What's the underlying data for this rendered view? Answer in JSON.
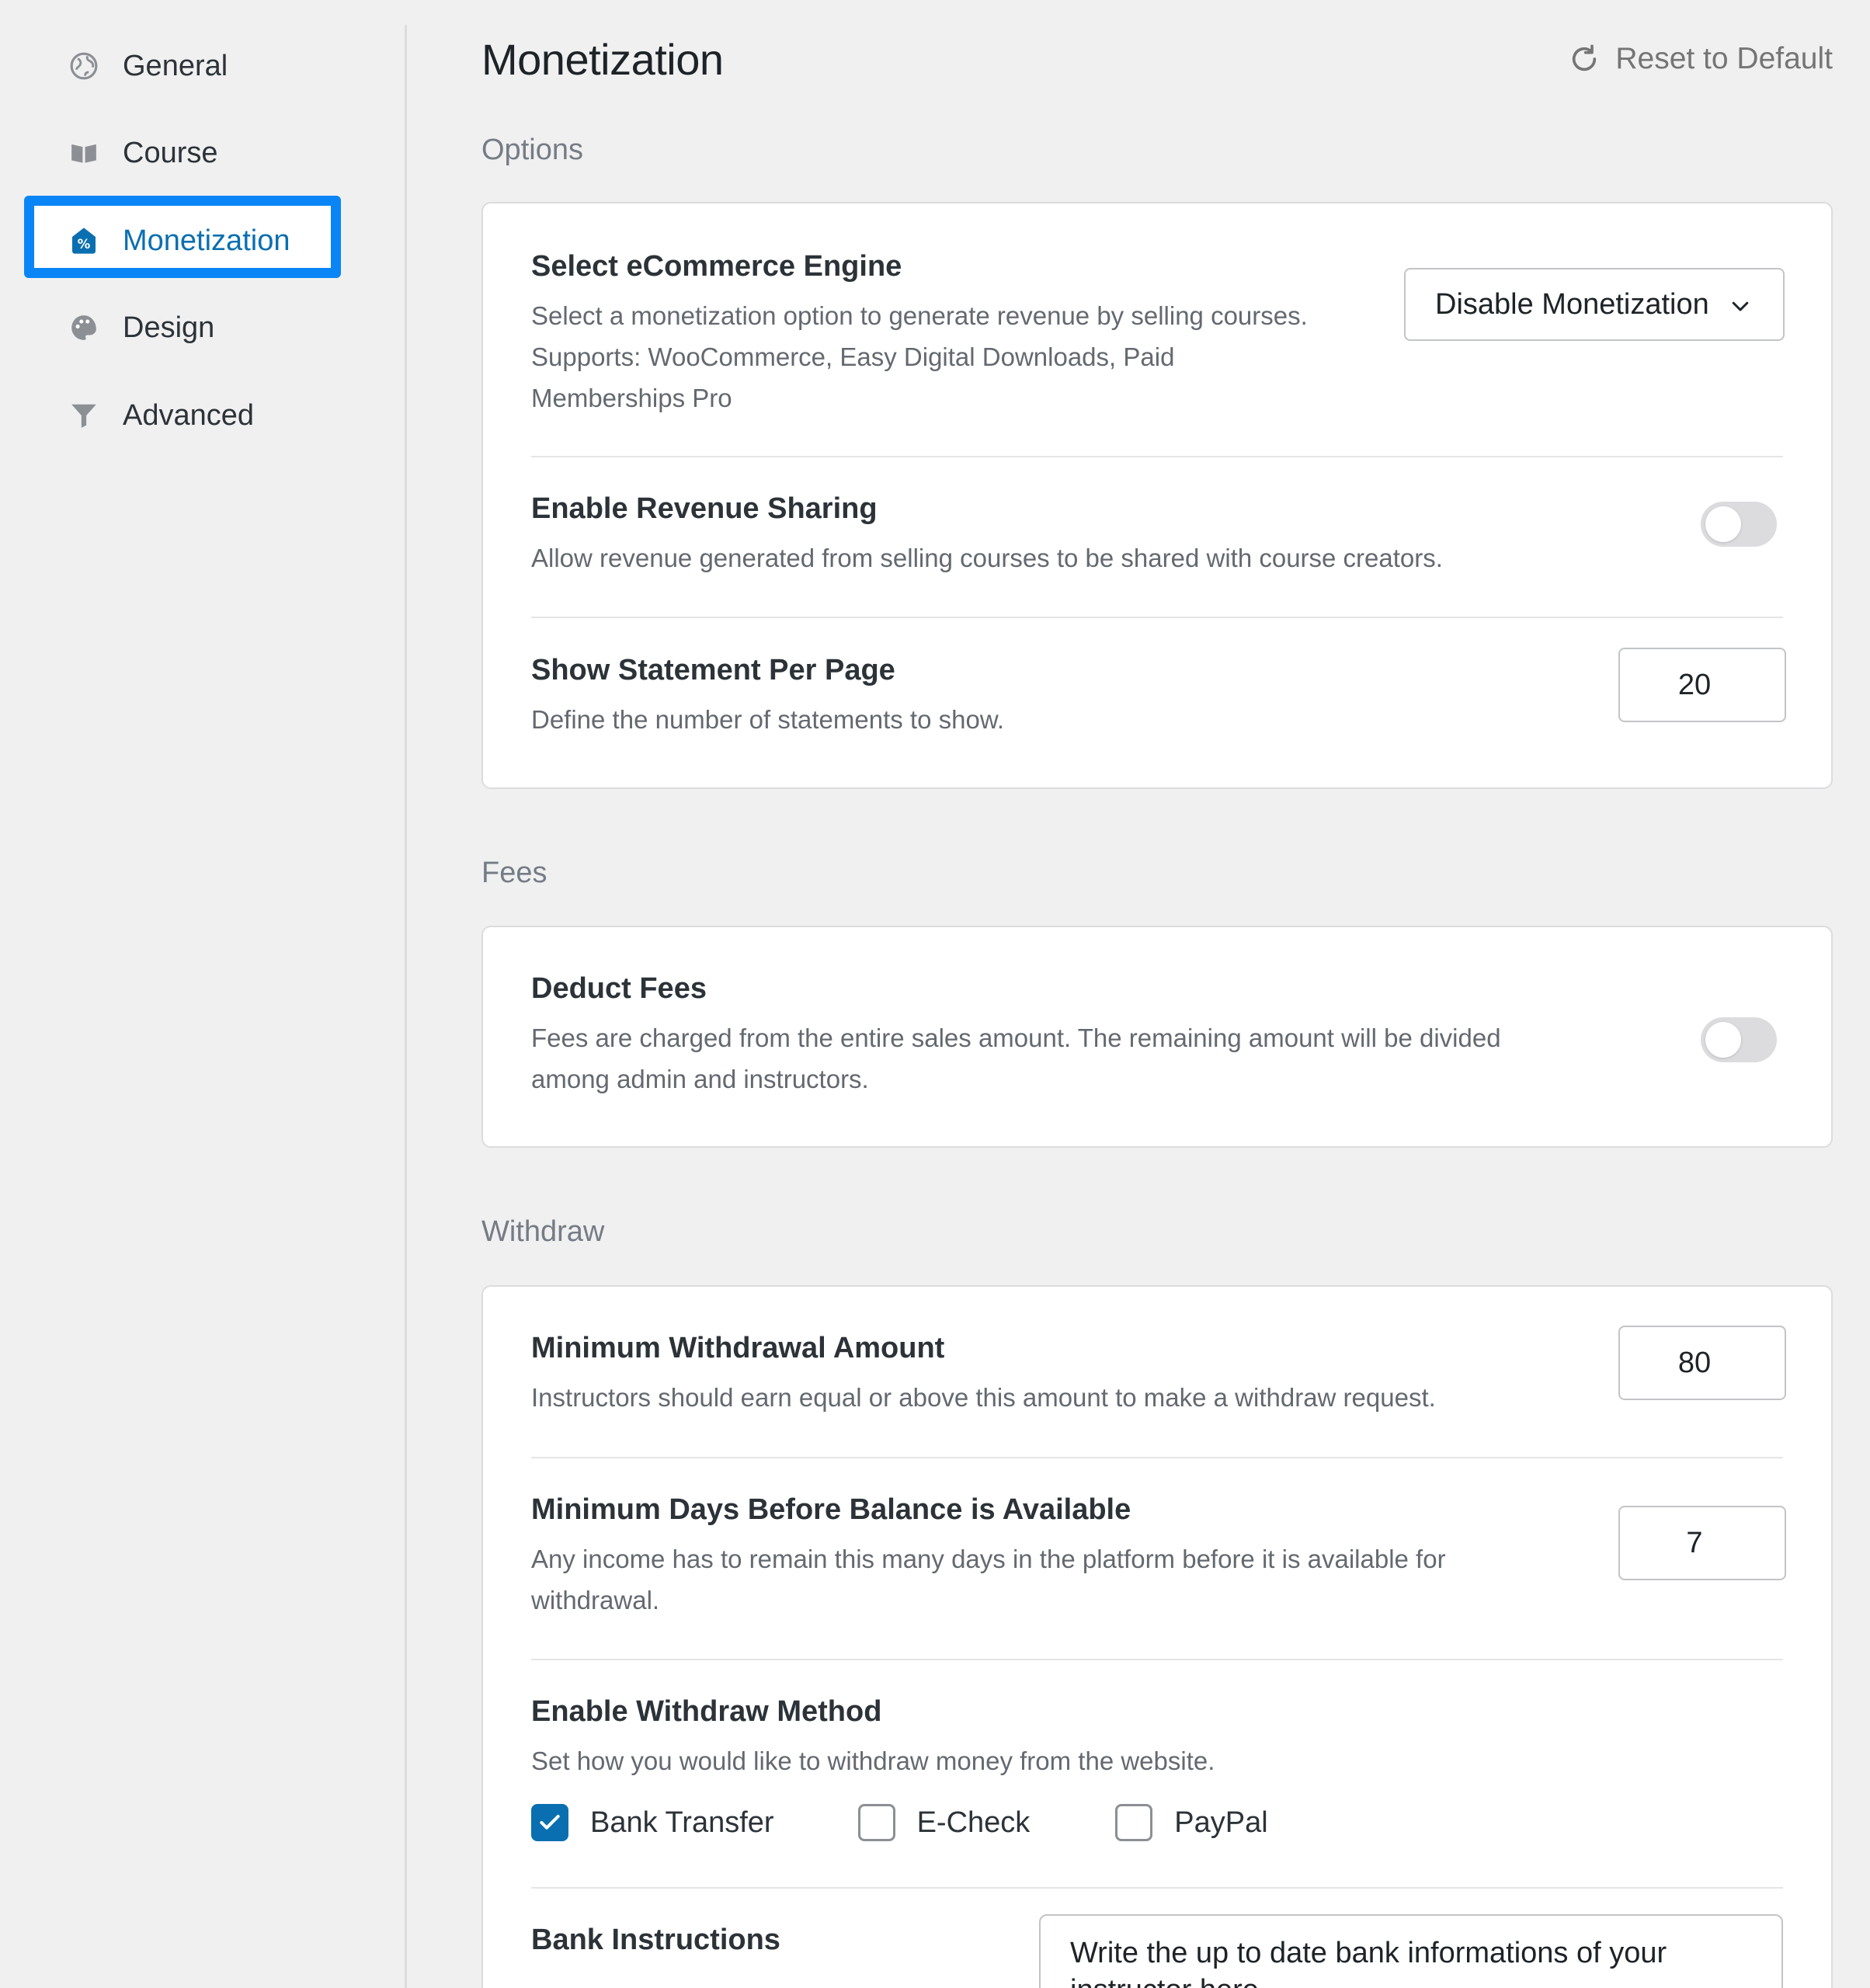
{
  "sidebar": {
    "items": [
      {
        "label": "General",
        "icon": "globe-icon"
      },
      {
        "label": "Course",
        "icon": "book-icon"
      },
      {
        "label": "Monetization",
        "icon": "monetization-icon",
        "active": true
      },
      {
        "label": "Design",
        "icon": "palette-icon"
      },
      {
        "label": "Advanced",
        "icon": "filter-icon"
      }
    ]
  },
  "header": {
    "title": "Monetization",
    "reset_label": "Reset to Default"
  },
  "options": {
    "section_label": "Options",
    "ecommerce": {
      "title": "Select eCommerce Engine",
      "desc": "Select a monetization option to generate revenue by selling courses. Supports: WooCommerce, Easy Digital Downloads, Paid Memberships Pro",
      "selected": "Disable Monetization"
    },
    "revenue_sharing": {
      "title": "Enable Revenue Sharing",
      "desc": "Allow revenue generated from selling courses to be shared with course creators.",
      "enabled": false
    },
    "statement_per_page": {
      "title": "Show Statement Per Page",
      "desc": "Define the number of statements to show.",
      "value": "20"
    }
  },
  "fees": {
    "section_label": "Fees",
    "deduct_fees": {
      "title": "Deduct Fees",
      "desc": "Fees are charged from the entire sales amount. The remaining amount will be divided among admin and instructors.",
      "enabled": false
    }
  },
  "withdraw": {
    "section_label": "Withdraw",
    "min_amount": {
      "title": "Minimum Withdrawal Amount",
      "desc": "Instructors should earn equal or above this amount to make a withdraw request.",
      "value": "80"
    },
    "min_days": {
      "title": "Minimum Days Before Balance is Available",
      "desc": "Any income has to remain this many days in the platform before it is available for withdrawal.",
      "value": "7"
    },
    "methods": {
      "title": "Enable Withdraw Method",
      "desc": "Set how you would like to withdraw money from the website.",
      "options": [
        {
          "label": "Bank Transfer",
          "checked": true
        },
        {
          "label": "E-Check",
          "checked": false
        },
        {
          "label": "PayPal",
          "checked": false
        }
      ]
    },
    "bank_instructions": {
      "title": "Bank Instructions",
      "value": "Write the up to date bank informations of your instructor here"
    }
  },
  "colors": {
    "accent": "#0a6fb0",
    "highlight": "#0a85f5",
    "background": "#f0f0f1"
  }
}
